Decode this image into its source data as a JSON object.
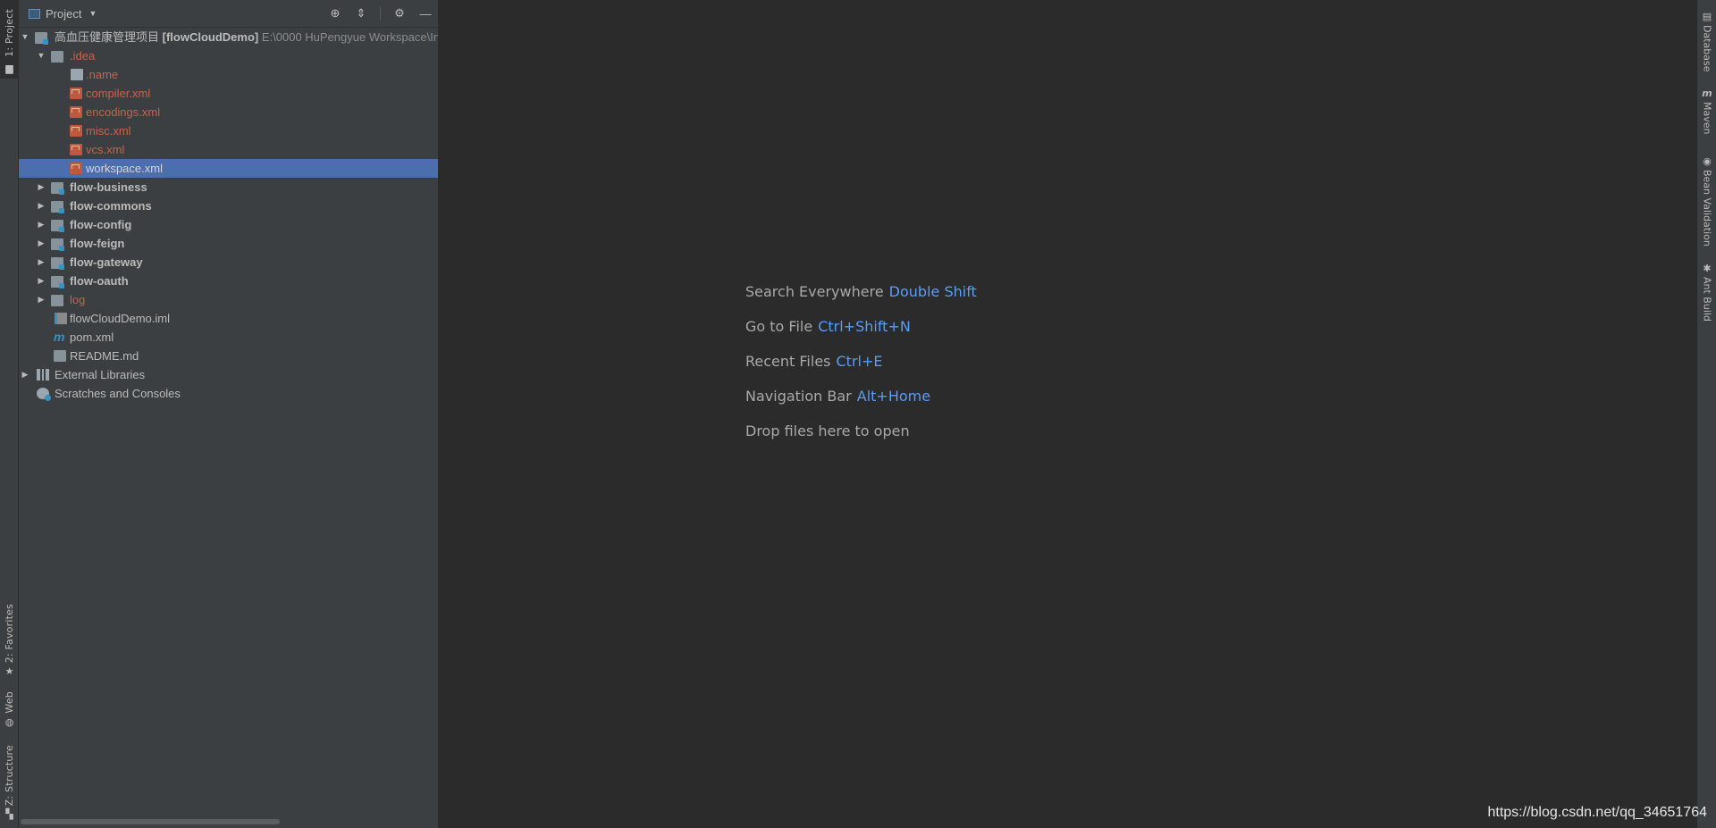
{
  "left_strip": {
    "project_tab": "1: Project",
    "favorites_tab": "2: Favorites",
    "web_tab": "Web",
    "structure_tab": "Z: Structure"
  },
  "panel": {
    "title": "Project",
    "tools": [
      "locate-icon",
      "collapse-icon",
      "gear-icon",
      "minimize-icon"
    ]
  },
  "tree": {
    "root_name": "高血压健康管理项目",
    "root_module": "[flowCloudDemo]",
    "root_path": "E:\\0000 HuPengyue Workspace\\Int",
    "idea": ".idea",
    "idea_files": [
      ".name",
      "compiler.xml",
      "encodings.xml",
      "misc.xml",
      "vcs.xml",
      "workspace.xml"
    ],
    "modules": [
      "flow-business",
      "flow-commons",
      "flow-config",
      "flow-feign",
      "flow-gateway",
      "flow-oauth"
    ],
    "log": "log",
    "root_files": [
      "flowCloudDemo.iml",
      "pom.xml",
      "README.md"
    ],
    "external_libraries": "External Libraries",
    "scratches": "Scratches and Consoles"
  },
  "editor": {
    "hints": [
      {
        "label": "Search Everywhere",
        "key": "Double Shift"
      },
      {
        "label": "Go to File",
        "key": "Ctrl+Shift+N"
      },
      {
        "label": "Recent Files",
        "key": "Ctrl+E"
      },
      {
        "label": "Navigation Bar",
        "key": "Alt+Home"
      },
      {
        "label": "Drop files here to open",
        "key": ""
      }
    ]
  },
  "right_strip": {
    "database_tab": "Database",
    "maven_tab": "Maven",
    "bean_validation_tab": "Bean Validation",
    "ant_build_tab": "Ant Build"
  },
  "watermark": "https://blog.csdn.net/qq_34651764",
  "colors": {
    "selection": "#4b6eaf",
    "shortcut": "#589df6",
    "ignored_file": "#c8624b"
  }
}
